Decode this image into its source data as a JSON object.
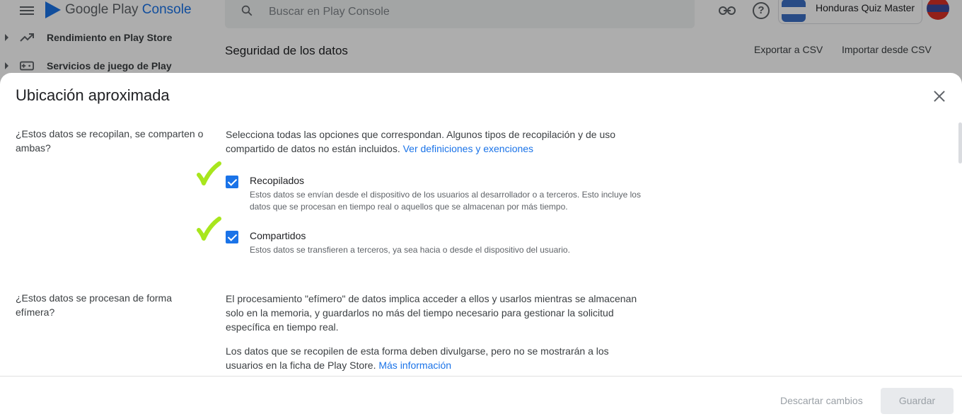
{
  "header": {
    "logo_text_google": "Google Play",
    "logo_text_console": "Console",
    "search_placeholder": "Buscar en Play Console",
    "app_name": "Honduras Quiz Master"
  },
  "sidebar": {
    "items": [
      {
        "label": "Rendimiento en Play Store",
        "icon": "trending-up-icon"
      },
      {
        "label": "Servicios de juego de Play",
        "icon": "gamepad-icon"
      }
    ]
  },
  "page": {
    "title": "Seguridad de los datos",
    "export_label": "Exportar a CSV",
    "import_label": "Importar desde CSV"
  },
  "dialog": {
    "title": "Ubicación aproximada",
    "q1": {
      "label": "¿Estos datos se recopilan, se comparten o ambas?",
      "intro": "Selecciona todas las opciones que correspondan. Algunos tipos de recopilación y de uso compartido de datos no están incluidos.",
      "intro_link": "Ver definiciones y exenciones",
      "options": [
        {
          "label": "Recopilados",
          "checked": true,
          "desc": "Estos datos se envían desde el dispositivo de los usuarios al desarrollador o a terceros. Esto incluye los datos que se procesan en tiempo real o aquellos que se almacenan por más tiempo."
        },
        {
          "label": "Compartidos",
          "checked": true,
          "desc": "Estos datos se transfieren a terceros, ya sea hacia o desde el dispositivo del usuario."
        }
      ]
    },
    "q2": {
      "label": "¿Estos datos se procesan de forma efímera?",
      "p1": "El procesamiento \"efímero\" de datos implica acceder a ellos y usarlos mientras se almacenan solo en la memoria, y guardarlos no más del tiempo necesario para gestionar la solicitud específica en tiempo real.",
      "p2": "Los datos que se recopilen de esta forma deben divulgarse, pero no se mostrarán a los usuarios en la ficha de Play Store.",
      "p2_link": "Más información"
    },
    "footer": {
      "discard_label": "Descartar cambios",
      "save_label": "Guardar"
    }
  },
  "colors": {
    "accent": "#1a73e8",
    "annotation_check": "#a8e61d"
  }
}
